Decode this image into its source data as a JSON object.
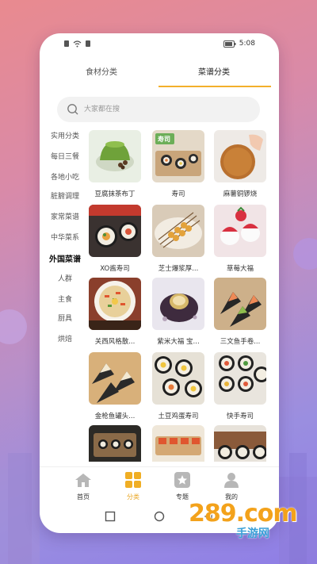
{
  "status": {
    "time": "5:08",
    "battery": "80"
  },
  "tabs": [
    {
      "label": "食材分类",
      "active": false
    },
    {
      "label": "菜谱分类",
      "active": true
    }
  ],
  "search": {
    "placeholder": "大家都在搜"
  },
  "sidebar": [
    {
      "label": "实用分类",
      "active": false
    },
    {
      "label": "每日三餐",
      "active": false
    },
    {
      "label": "各地小吃",
      "active": false
    },
    {
      "label": "脏腑调理",
      "active": false
    },
    {
      "label": "家常菜谱",
      "active": false
    },
    {
      "label": "中华菜系",
      "active": false
    },
    {
      "label": "外国菜谱",
      "active": true
    },
    {
      "label": "人群",
      "active": false
    },
    {
      "label": "主食",
      "active": false
    },
    {
      "label": "厨具",
      "active": false
    },
    {
      "label": "烘焙",
      "active": false
    }
  ],
  "recipes": [
    {
      "name": "豆腐抹茶布丁",
      "thumb_icon": "matcha-pudding-photo",
      "thumb_text": ""
    },
    {
      "name": "寿司",
      "thumb_icon": "sushi-photo",
      "thumb_text": "寿司"
    },
    {
      "name": "麻薯铜锣烧",
      "thumb_icon": "dorayaki-photo",
      "thumb_text": ""
    },
    {
      "name": "XO酱寿司",
      "thumb_icon": "sushi-roll-photo",
      "thumb_text": ""
    },
    {
      "name": "芝士爆浆厚...",
      "thumb_icon": "cheese-skewer-photo",
      "thumb_text": ""
    },
    {
      "name": "草莓大福",
      "thumb_icon": "strawberry-daifuku-photo",
      "thumb_text": ""
    },
    {
      "name": "关西风格散...",
      "thumb_icon": "chirashi-photo",
      "thumb_text": ""
    },
    {
      "name": "紫米大福 宝...",
      "thumb_icon": "purple-rice-daifuku-photo",
      "thumb_text": ""
    },
    {
      "name": "三文鱼手卷...",
      "thumb_icon": "salmon-handroll-photo",
      "thumb_text": ""
    },
    {
      "name": "金枪鱼罐头...",
      "thumb_icon": "tuna-handroll-photo",
      "thumb_text": ""
    },
    {
      "name": "土豆鸡蛋寿司",
      "thumb_icon": "potato-egg-sushi-photo",
      "thumb_text": ""
    },
    {
      "name": "快手寿司",
      "thumb_icon": "quick-sushi-photo",
      "thumb_text": ""
    },
    {
      "name": "",
      "thumb_icon": "sushi-tray-photo",
      "thumb_text": ""
    },
    {
      "name": "",
      "thumb_icon": "sushi-board-photo",
      "thumb_text": ""
    },
    {
      "name": "",
      "thumb_icon": "sushi-plate-photo",
      "thumb_text": ""
    }
  ],
  "bottom_nav": [
    {
      "label": "首页",
      "icon": "home-icon",
      "active": false
    },
    {
      "label": "分类",
      "icon": "grid-icon",
      "active": true
    },
    {
      "label": "专题",
      "icon": "star-icon",
      "active": false
    },
    {
      "label": "我的",
      "icon": "user-icon",
      "active": false
    }
  ],
  "watermark": {
    "text": "289.com",
    "subtext": "手游网"
  },
  "colors": {
    "accent": "#f3b02b",
    "nav_active": "#e9a623",
    "background_top": "#e98a8f",
    "background_bottom": "#8f7ee6"
  }
}
